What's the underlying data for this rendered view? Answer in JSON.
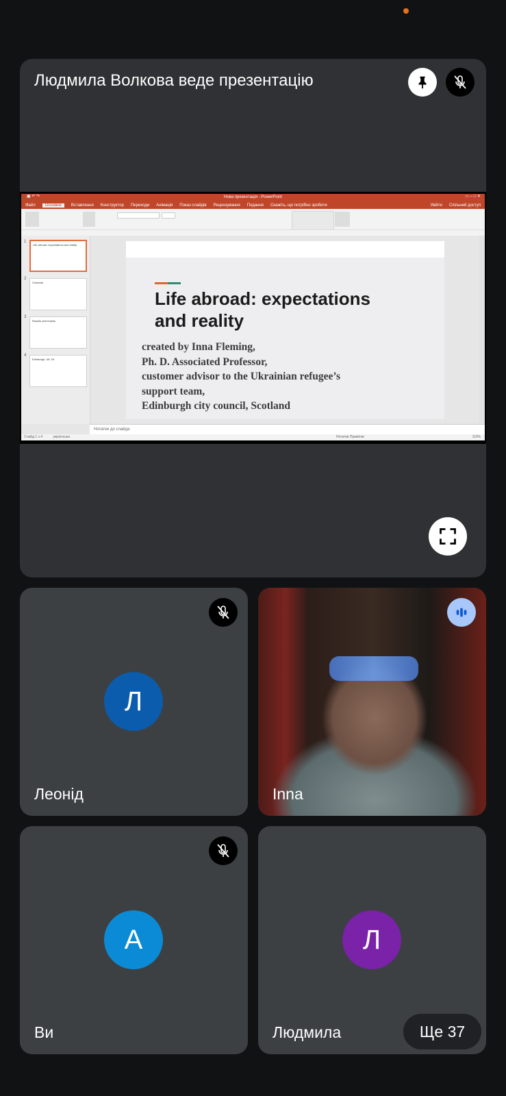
{
  "presenter": {
    "title": "Людмила Волкова веде презентацію"
  },
  "slide_app": {
    "window_title": "Нова презентація - PowerPoint",
    "tabs": [
      "Файл",
      "Основне",
      "Вставлення",
      "Конструктор",
      "Переходи",
      "Анімація",
      "Показ слайдів",
      "Рецензування",
      "Подання",
      "Скажіть, що потрібно зробити"
    ],
    "account": "Увійти",
    "share": "Спільний доступ",
    "thumbnails": [
      {
        "num": "1",
        "text": "Life abroad: expectations and reality"
      },
      {
        "num": "2",
        "text": "Contents"
      },
      {
        "num": "3",
        "text": "Results and thanks"
      },
      {
        "num": "4",
        "text": "Edinburgh, UK, IN"
      }
    ],
    "notes_placeholder": "Нотатки до слайда",
    "status_left": "Слайд 1 з 4",
    "status_lang": "українська",
    "status_right": "Нотатки   Примітки",
    "zoom": "110%"
  },
  "slide": {
    "heading_line1": "Life abroad: expectations",
    "heading_line2": "and reality",
    "body_line1": "created by Inna Fleming,",
    "body_line2": "Ph. D. Associated Professor,",
    "body_line3": "customer advisor to the Ukrainian refugee’s",
    "body_line4": "support team,",
    "body_line5": "Edinburgh city council, Scotland"
  },
  "participants": [
    {
      "name": "Леонід",
      "initial": "Л",
      "color": "#0b5cad",
      "muted": true
    },
    {
      "name": "Inna",
      "video": true,
      "speaking": true
    },
    {
      "name": "Ви",
      "initial": "А",
      "color": "#0b8bd6",
      "muted": true
    },
    {
      "name": "Людмила",
      "initial": "Л",
      "color": "#7a22a8"
    }
  ],
  "more_label": "Ще 37",
  "icons": {
    "pin": "pin-icon",
    "mic_off": "mic-off-icon",
    "fullscreen": "fullscreen-icon",
    "speaking": "audio-level-icon"
  }
}
